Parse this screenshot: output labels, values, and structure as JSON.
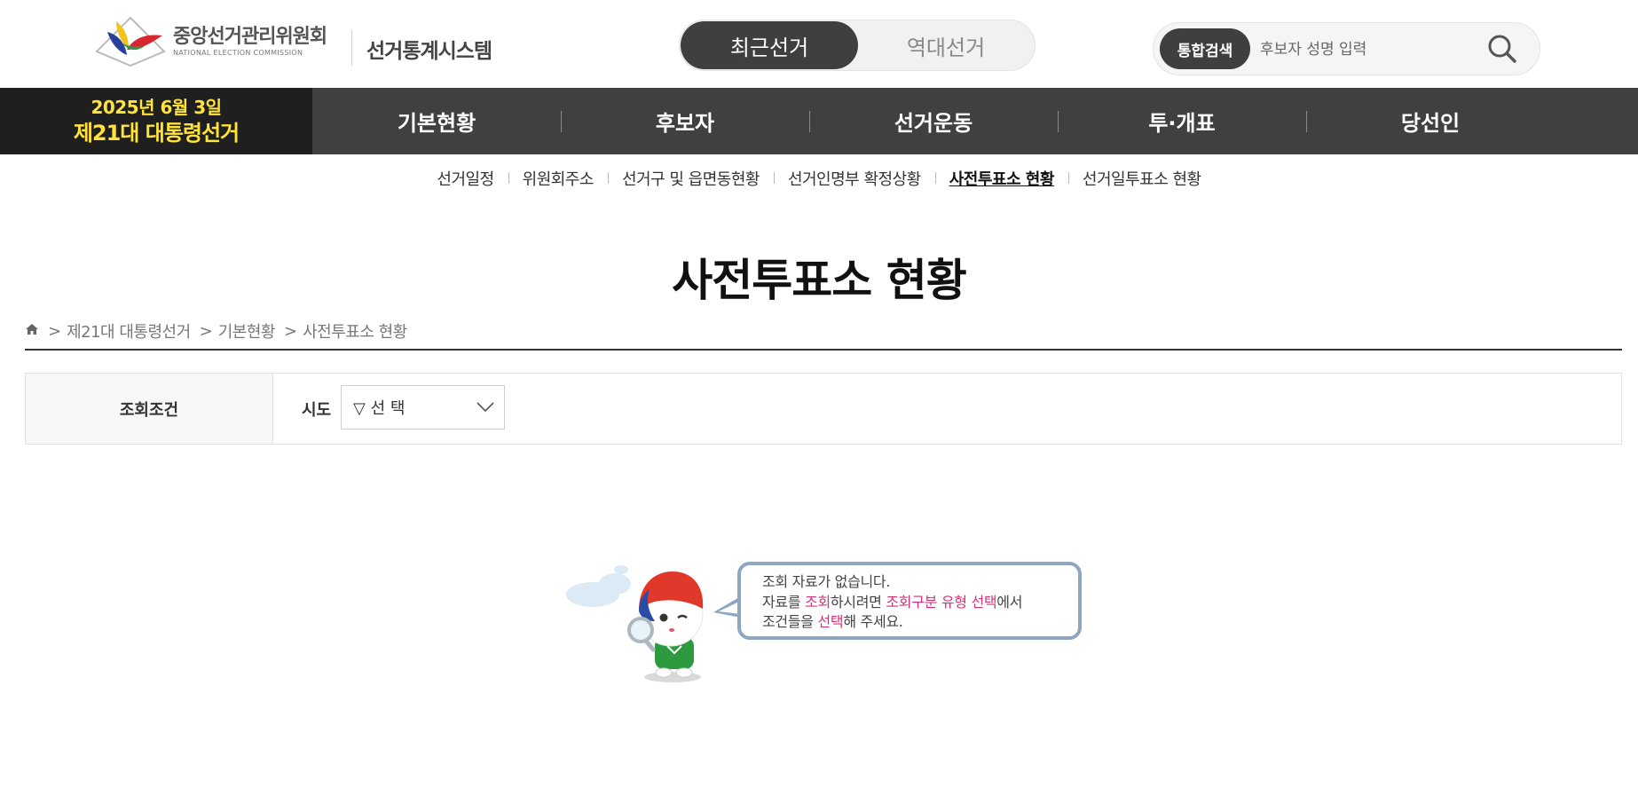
{
  "header": {
    "logo_ko": "중앙선거관리위원회",
    "logo_en": "NATIONAL ELECTION COMMISSION",
    "system_name": "선거통계시스템",
    "toggle": {
      "active": "최근선거",
      "inactive": "역대선거"
    },
    "search": {
      "badge": "통합검색",
      "placeholder": "후보자 성명 입력"
    }
  },
  "election": {
    "date": "2025년 6월 3일",
    "name": "제21대 대통령선거"
  },
  "main_nav": [
    "기본현황",
    "후보자",
    "선거운동",
    "투·개표",
    "당선인"
  ],
  "sub_nav": [
    "선거일정",
    "위원회주소",
    "선거구 및 읍면동현황",
    "선거인명부 확정상황",
    "사전투표소 현황",
    "선거일투표소 현황"
  ],
  "sub_nav_active": "사전투표소 현황",
  "page_title": "사전투표소 현황",
  "breadcrumb": [
    "제21대 대통령선거",
    "기본현황",
    "사전투표소 현황"
  ],
  "query": {
    "label": "조회조건",
    "field_label": "시도",
    "select_value": "▽ 선 택"
  },
  "empty_state": {
    "line1": "조회 자료가 없습니다.",
    "line2_a": "자료를 ",
    "line2_b": "조회",
    "line2_c": "하시려면 ",
    "line2_d": "조회구분 유형 선택",
    "line2_e": "에서",
    "line3_a": "조건들을 ",
    "line3_b": "선택",
    "line3_c": "해 주세요."
  },
  "colors": {
    "nav_bg": "#404040",
    "election_bg": "#1f1f1f",
    "election_text": "#ffe33a",
    "highlight": "#d4327a",
    "bubble_border": "#8fa6c2"
  }
}
